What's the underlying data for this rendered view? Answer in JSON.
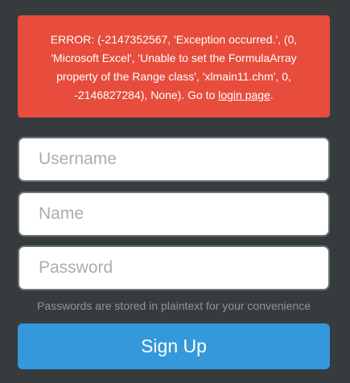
{
  "error": {
    "message": "ERROR: (-2147352567, 'Exception occurred.', (0, 'Microsoft Excel', 'Unable to set the FormulaArray property of the Range class', 'xlmain11.chm', 0, -2146827284), None). Go to ",
    "link_text": "login page",
    "suffix": "."
  },
  "form": {
    "username_placeholder": "Username",
    "name_placeholder": "Name",
    "password_placeholder": "Password",
    "hint": "Passwords are stored in plaintext for your convenience",
    "submit_label": "Sign Up"
  },
  "colors": {
    "background": "#363b3d",
    "error": "#e74c3c",
    "button": "#3498db"
  }
}
